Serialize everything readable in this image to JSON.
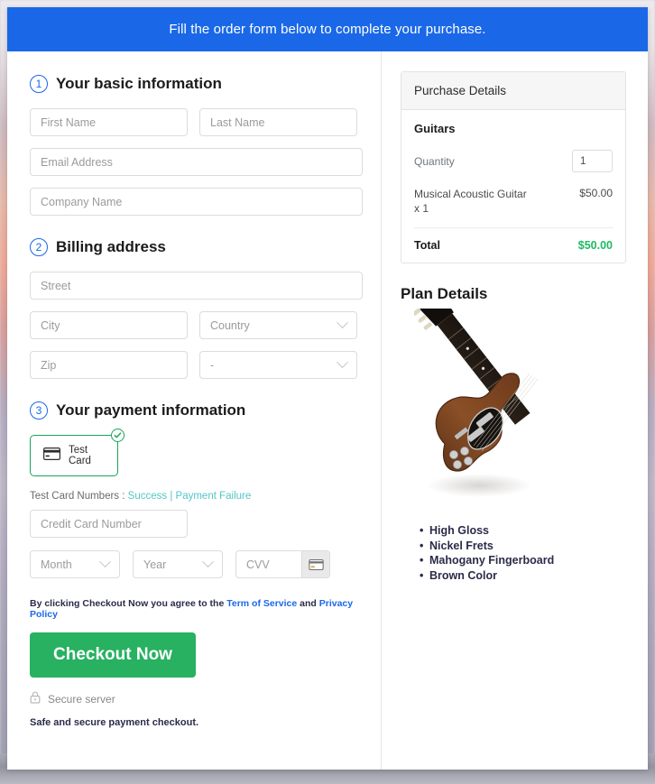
{
  "banner": {
    "text": "Fill the order form below to complete your purchase."
  },
  "steps": {
    "basic": {
      "number": "1",
      "title": "Your basic information"
    },
    "billing": {
      "number": "2",
      "title": "Billing address"
    },
    "payment": {
      "number": "3",
      "title": "Your payment information"
    }
  },
  "fields": {
    "first_name": {
      "placeholder": "First Name",
      "value": ""
    },
    "last_name": {
      "placeholder": "Last Name",
      "value": ""
    },
    "email": {
      "placeholder": "Email Address",
      "value": ""
    },
    "company": {
      "placeholder": "Company Name",
      "value": ""
    },
    "street": {
      "placeholder": "Street",
      "value": ""
    },
    "city": {
      "placeholder": "City",
      "value": ""
    },
    "country": {
      "placeholder": "Country",
      "value": ""
    },
    "zip": {
      "placeholder": "Zip",
      "value": ""
    },
    "state": {
      "placeholder": "-",
      "value": ""
    },
    "credit_card": {
      "placeholder": "Credit Card Number",
      "value": ""
    },
    "month": {
      "placeholder": "Month",
      "value": ""
    },
    "year": {
      "placeholder": "Year",
      "value": ""
    },
    "cvv": {
      "placeholder": "CVV",
      "value": ""
    }
  },
  "payment": {
    "card_tile_label": "Test  Card",
    "test_numbers_label": "Test Card Numbers :",
    "success_link": "Success",
    "separator": "|",
    "failure_link": "Payment Failure"
  },
  "agreement": {
    "prefix": "By clicking Checkout Now you agree to the",
    "terms_link": "Term of Service",
    "conjunction": "and",
    "privacy_link": "Privacy Policy"
  },
  "actions": {
    "checkout_label": "Checkout Now",
    "secure_server": "Secure server",
    "safe_note": "Safe and secure payment checkout."
  },
  "purchase": {
    "header": "Purchase Details",
    "product": "Guitars",
    "quantity_label": "Quantity",
    "quantity_value": "1",
    "line_item_desc": "Musical Acoustic Guitar x 1",
    "line_item_amount": "$50.00",
    "total_label": "Total",
    "total_amount": "$50.00"
  },
  "plan": {
    "title": "Plan Details",
    "image_alt": "electric-guitar-image",
    "features": [
      "High Gloss",
      "Nickel Frets",
      "Mahogany Fingerboard",
      "Brown Color"
    ]
  },
  "colors": {
    "banner_blue": "#1a68e8",
    "accent_blue": "#1a68e8",
    "success_green": "#27b161",
    "total_green": "#1fb963",
    "link_teal": "#53c5c8",
    "card_border_green": "#18a558"
  }
}
